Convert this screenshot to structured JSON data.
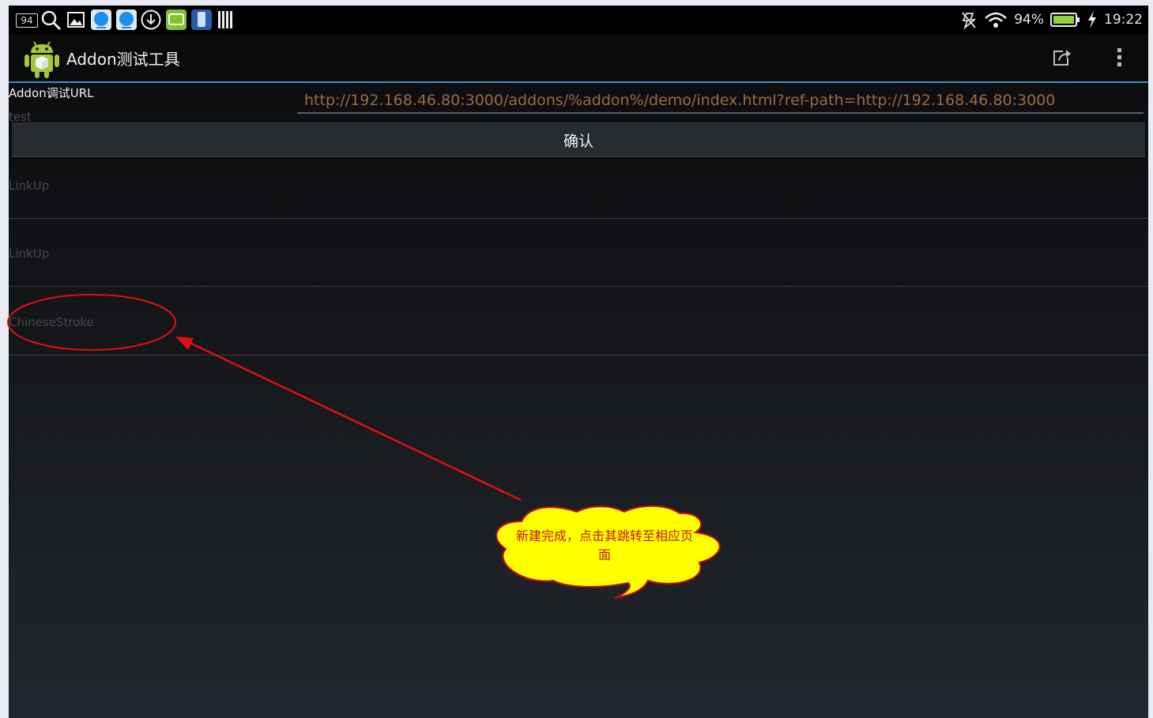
{
  "status_bar": {
    "notification_badge": "94",
    "battery_percent": "94%",
    "time": "19:22"
  },
  "action_bar": {
    "title": "Addon测试工具"
  },
  "form": {
    "url_label": "Addon调试URL",
    "url_value": "http://192.168.46.80:3000/addons/%addon%/demo/index.html?ref-path=http://192.168.46.80:3000",
    "second_label": "test",
    "confirm_label": "确认"
  },
  "list": {
    "items": [
      {
        "label": "LinkUp"
      },
      {
        "label": "LinkUp"
      },
      {
        "label": "ChineseStroke"
      }
    ]
  },
  "annotation": {
    "callout_text": "新建完成，点击其跳转至相应页面"
  },
  "colors": {
    "accent_line": "#3b8ec8",
    "annotation_red": "#e01010",
    "callout_fill": "#ffff00",
    "url_text": "#9b6a3f"
  }
}
